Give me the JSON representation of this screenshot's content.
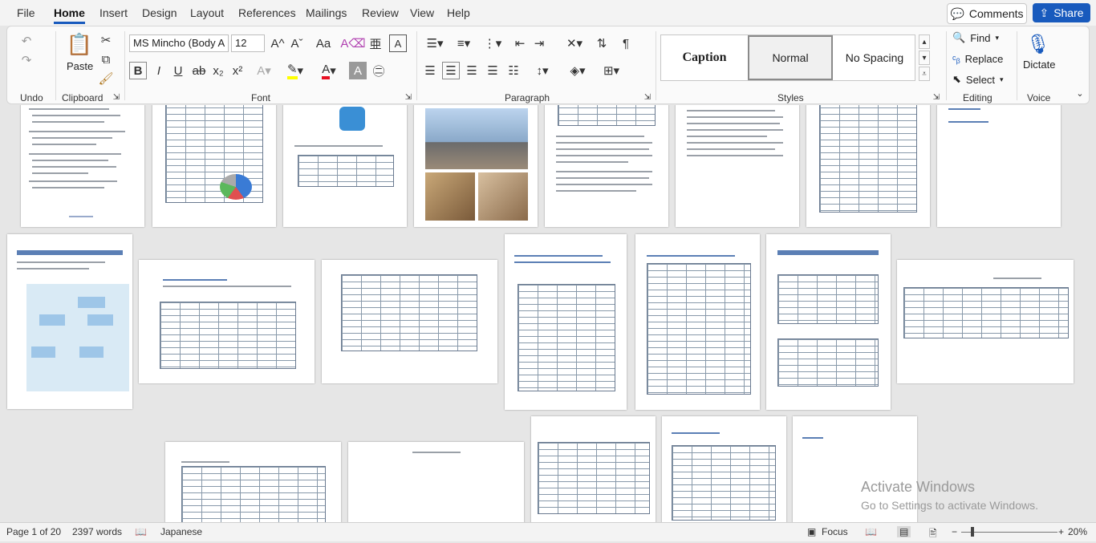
{
  "menu": {
    "tabs": [
      "File",
      "Home",
      "Insert",
      "Design",
      "Layout",
      "References",
      "Mailings",
      "Review",
      "View",
      "Help"
    ],
    "comments_label": "Comments",
    "share_label": "Share"
  },
  "ribbon": {
    "undo_group": "Undo",
    "clipboard_group": "Clipboard",
    "paste_label": "Paste",
    "font_group": "Font",
    "font_name": "MS Mincho (Body A",
    "font_size": "12",
    "paragraph_group": "Paragraph",
    "styles_group": "Styles",
    "styles": [
      "Caption",
      "Normal",
      "No Spacing"
    ],
    "editing_group": "Editing",
    "find_label": "Find",
    "replace_label": "Replace",
    "select_label": "Select",
    "voice_group": "Voice",
    "dictate_label": "Dictate",
    "icons": {
      "bold": "B",
      "italic": "I",
      "underline": "U",
      "strike": "ab",
      "subscript": "x₂",
      "superscript": "x²",
      "grow_font": "A^",
      "shrink_font": "Aˇ",
      "change_case": "Aa",
      "pilcrow": "¶"
    }
  },
  "watermark": {
    "line1": "Activate Windows",
    "line2": "Go to Settings to activate Windows."
  },
  "status": {
    "page": "Page 1 of 20",
    "words": "2397 words",
    "language": "Japanese",
    "focus": "Focus",
    "zoom": "20%"
  },
  "colors": {
    "accent": "#185abd",
    "highlight": "#ffff00",
    "font_color": "#e81123"
  }
}
